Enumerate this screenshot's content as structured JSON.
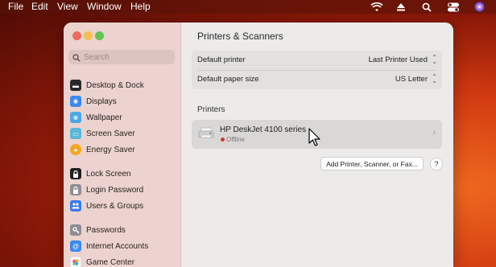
{
  "menubar": {
    "items": [
      "File",
      "Edit",
      "View",
      "Window",
      "Help"
    ],
    "icons": [
      "wifi-icon",
      "eject-icon",
      "search-icon",
      "control-center-icon",
      "siri-icon"
    ]
  },
  "window": {
    "title": "Printers & Scanners",
    "search": {
      "placeholder": "Search"
    },
    "sidebar": {
      "items": [
        {
          "label": "Desktop & Dock",
          "icon": "desktop-dock-icon",
          "color": "#2a2a2a"
        },
        {
          "label": "Displays",
          "icon": "displays-icon",
          "color": "#3a8af0"
        },
        {
          "label": "Wallpaper",
          "icon": "wallpaper-icon",
          "color": "#4aa8e8"
        },
        {
          "label": "Screen Saver",
          "icon": "screen-saver-icon",
          "color": "#59b8d8"
        },
        {
          "label": "Energy Saver",
          "icon": "energy-saver-icon",
          "color": "#f5a623"
        },
        {
          "label": "Lock Screen",
          "icon": "lock-icon",
          "color": "#1f1f1f"
        },
        {
          "label": "Login Password",
          "icon": "login-password-icon",
          "color": "#8e8e93"
        },
        {
          "label": "Users & Groups",
          "icon": "users-groups-icon",
          "color": "#3a7bea"
        },
        {
          "label": "Passwords",
          "icon": "passwords-icon",
          "color": "#8e8e93"
        },
        {
          "label": "Internet Accounts",
          "icon": "internet-accounts-icon",
          "color": "#3a8af0"
        },
        {
          "label": "Game Center",
          "icon": "game-center-icon",
          "color": "#e8a0c0"
        }
      ]
    },
    "settings": {
      "default_printer": {
        "label": "Default printer",
        "value": "Last Printer Used"
      },
      "default_paper": {
        "label": "Default paper size",
        "value": "US Letter"
      }
    },
    "printers_section": "Printers",
    "printer": {
      "name": "HP DeskJet 4100 series",
      "status": "Offline",
      "status_color": "#d6362c"
    },
    "add_button": "Add Printer, Scanner, or Fax...",
    "help_button": "?"
  }
}
